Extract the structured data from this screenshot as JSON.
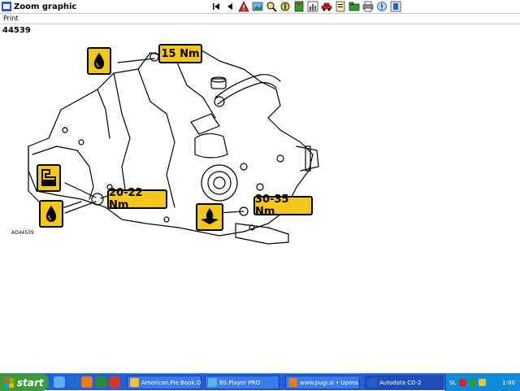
{
  "window": {
    "title": "Zoom graphic"
  },
  "toolbar": {
    "buttons": [
      "first-icon",
      "previous-icon",
      "warning-icon",
      "image-icon",
      "zoom-icon",
      "tools-icon",
      "book-icon",
      "chart-icon",
      "car-icon",
      "document-icon",
      "folder-icon",
      "printer-icon",
      "help-icon",
      "exit-icon"
    ]
  },
  "menu": {
    "print": "Print"
  },
  "graphic": {
    "number": "44539",
    "corner_code": "AD44539",
    "torque_top": "15 Nm",
    "torque_left": "20-22 Nm",
    "torque_right": "30-35 Nm"
  },
  "taskbar": {
    "start": "start",
    "tasks": [
      {
        "label": "American.Pie.Book.O..."
      },
      {
        "label": "BS.Player PRO"
      },
      {
        "label": "www.pugi.si • Upora..."
      },
      {
        "label": "Autodata CD-2"
      }
    ],
    "language": "SL",
    "clock": "1:00"
  }
}
